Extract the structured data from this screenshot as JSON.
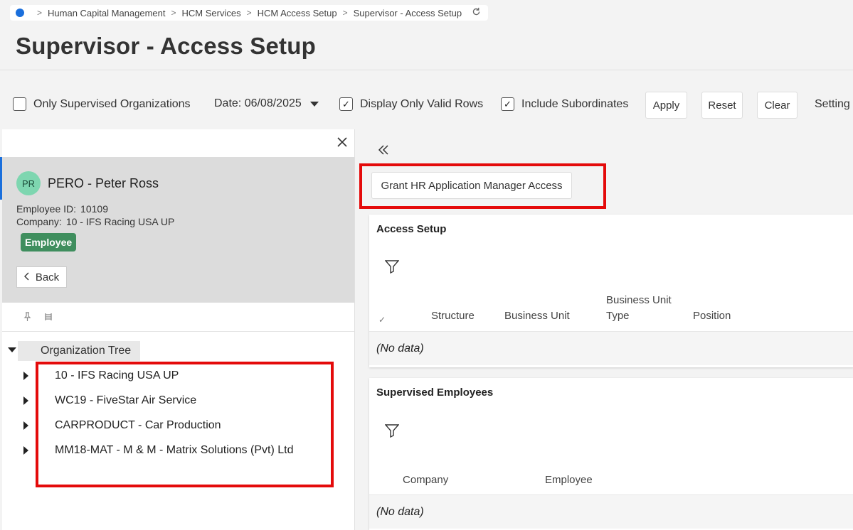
{
  "breadcrumb": {
    "items": [
      "Human Capital Management",
      "HCM Services",
      "HCM Access Setup",
      "Supervisor - Access Setup"
    ],
    "separator": ">"
  },
  "page": {
    "title": "Supervisor - Access Setup"
  },
  "toolbar": {
    "only_supervised_label": "Only Supervised Organizations",
    "date_label": "Date: 06/08/2025",
    "display_valid_label": "Display Only Valid Rows",
    "include_subordinates_label": "Include Subordinates",
    "apply_label": "Apply",
    "reset_label": "Reset",
    "clear_label": "Clear",
    "settings_label": "Setting",
    "check_mark": "✓"
  },
  "employee": {
    "initials": "PR",
    "name": "PERO - Peter Ross",
    "id_label": "Employee ID:",
    "id_value": "10109",
    "company_label": "Company:",
    "company_value": "10 - IFS Racing USA UP",
    "badge": "Employee",
    "back_label": "Back"
  },
  "tree": {
    "root_label": "Organization Tree",
    "items": [
      "10 - IFS Racing USA UP",
      "WC19 - FiveStar Air Service",
      "CARPRODUCT - Car Production",
      "MM18-MAT - M & M - Matrix Solutions (Pvt) Ltd"
    ]
  },
  "right": {
    "grant_button": "Grant HR Application Manager Access",
    "access_setup": {
      "title": "Access Setup",
      "columns": [
        "Structure",
        "Business Unit",
        "Business Unit Type",
        "Position"
      ],
      "no_data": "(No data)"
    },
    "supervised": {
      "title": "Supervised Employees",
      "columns": [
        "Company",
        "Employee"
      ],
      "no_data": "(No data)"
    }
  },
  "colors": {
    "accent": "#1a6fdc",
    "badge": "#3f8e5e",
    "avatar": "#7ed6b0",
    "highlight_frame": "#e40a0a"
  }
}
